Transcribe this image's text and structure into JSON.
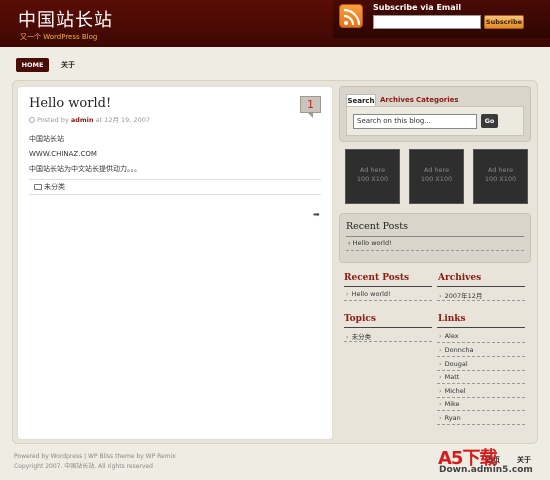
{
  "site": {
    "title": "中国站长站",
    "description": "又一个 WordPress Blog"
  },
  "subscribe": {
    "label": "Subscribe via Email",
    "button": "Subscribe",
    "email_value": ""
  },
  "nav": {
    "home": "HOME",
    "about": "关于"
  },
  "post": {
    "title": "Hello world!",
    "comments": "1",
    "posted_by": "Posted by",
    "author": "admin",
    "date": "at 12月 19, 2007",
    "lines": [
      "中国站长站",
      "WWW.CHINAZ.COM",
      "中国站长站为中文站长提供动力。。。"
    ],
    "category": "未分类"
  },
  "sidebar": {
    "tabs": [
      "Search",
      "Archives",
      "Categories"
    ],
    "search_value": "Search on this blog...",
    "go": "Go",
    "ads": [
      {
        "line1": "Ad here",
        "line2": "100 X100"
      },
      {
        "line1": "Ad here",
        "line2": "100 X100"
      },
      {
        "line1": "Ad here",
        "line2": "100 X100"
      }
    ],
    "recent_box": {
      "title": "Recent Posts",
      "item": "Hello world!"
    },
    "recent": {
      "title": "Recent Posts",
      "item": "Hello world!"
    },
    "archives": {
      "title": "Archives",
      "item": "2007年12月"
    },
    "topics": {
      "title": "Topics",
      "item": "未分类"
    },
    "links": {
      "title": "Links",
      "items": [
        "Alex",
        "Donncha",
        "Dougal",
        "Matt",
        "Michel",
        "Mike",
        "Ryan"
      ]
    }
  },
  "footer": {
    "line1": "Powered by Wordpress | WP Bliss theme by WP Remix",
    "line2": "Copyright 2007. 中国站长站. All rights reserved",
    "home": "首页",
    "about": "关于"
  },
  "watermark": {
    "logo": "A5下载",
    "site": "Down.admin5.com"
  },
  "colors": {
    "header": "#4a0a04",
    "accent": "#8b1a10",
    "button": "#e38b1f"
  }
}
